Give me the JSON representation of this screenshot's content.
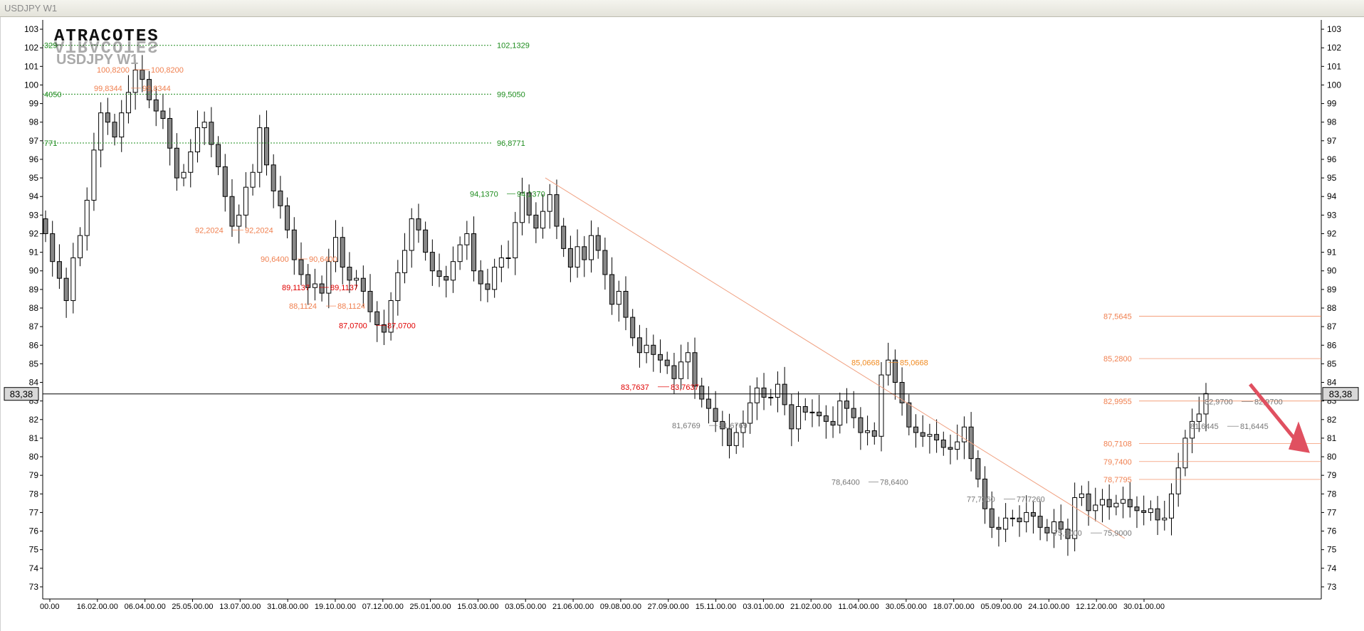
{
  "window": {
    "title": "USDJPY W1"
  },
  "header": {
    "logo": "ATRACOTES",
    "symbol": "USDJPY W1"
  },
  "current_price": {
    "label": "83,38",
    "value": 83.38,
    "color": "#000000"
  },
  "colors": {
    "up_fill": "#ffffff",
    "down_fill": "#888888",
    "wick": "#000000",
    "support_levels": "#1e8c1e",
    "resistance_levels": "#f08050",
    "pivot_labels": "#f08050",
    "trend_line": "#f0a080",
    "forecast_arrow": "#e05060"
  },
  "chart_data": {
    "type": "candlestick",
    "title": "USDJPY W1",
    "xlabel": "",
    "ylabel": "",
    "ylim": [
      72,
      104
    ],
    "y_ticks": [
      73,
      74,
      75,
      76,
      77,
      78,
      79,
      80,
      81,
      82,
      83,
      84,
      85,
      86,
      87,
      88,
      89,
      90,
      91,
      92,
      93,
      94,
      95,
      96,
      97,
      98,
      99,
      100,
      101,
      102,
      103
    ],
    "x_tick_labels": [
      "00.00",
      "16.02.00.00",
      "06.04.00.00",
      "25.05.00.00",
      "13.07.00.00",
      "31.08.00.00",
      "19.10.00.00",
      "07.12.00.00",
      "25.01.00.00",
      "15.03.00.00",
      "03.05.00.00",
      "21.06.00.00",
      "09.08.00.00",
      "27.09.00.00",
      "15.11.00.00",
      "03.01.00.00",
      "21.02.00.00",
      "11.04.00.00",
      "30.05.00.00",
      "18.07.00.00",
      "05.09.00.00",
      "24.10.00.00",
      "12.12.00.00",
      "30.01.00.00"
    ],
    "series_close": [
      92,
      90.5,
      89.6,
      88.4,
      90.7,
      91.9,
      93.8,
      96.5,
      98.5,
      98,
      97.2,
      98.5,
      99.6,
      100.8,
      100.3,
      99.2,
      98.6,
      98.2,
      96.6,
      95,
      95.3,
      96.4,
      97.7,
      98,
      96.8,
      95.6,
      94,
      92.4,
      93,
      94.5,
      95.3,
      97.7,
      95.7,
      94.3,
      93.5,
      92.2,
      90.6,
      89.8,
      89.1,
      89.3,
      88.8,
      90.5,
      91.8,
      90.2,
      89.5,
      89.6,
      88.9,
      87.8,
      87.1,
      86.7,
      88.4,
      89.9,
      91.1,
      92.8,
      92.2,
      91,
      90,
      89.7,
      89.5,
      90.5,
      91.4,
      92,
      90,
      89.3,
      89,
      90.2,
      90.7,
      90.7,
      92.6,
      94.2,
      93,
      92.3,
      93.2,
      94.1,
      92.4,
      91.2,
      90.2,
      91.3,
      90.6,
      91.9,
      91.1,
      89.8,
      88.2,
      88.9,
      87.5,
      86.4,
      85.6,
      86,
      85.5,
      85.2,
      84.9,
      84.2,
      85.1,
      85.6,
      83.8,
      83.1,
      82.6,
      81.9,
      81.5,
      80.6,
      81.3,
      81.8,
      82.9,
      83.7,
      83.2,
      83.2,
      83.9,
      82.8,
      81.5,
      82.7,
      82.4,
      82.4,
      82.2,
      81.9,
      81.7,
      83,
      82.6,
      82.1,
      81.3,
      81.4,
      81.1,
      84.4,
      85.2,
      84,
      82.9,
      81.6,
      81.3,
      81.1,
      81.2,
      80.9,
      80.5,
      80.4,
      80.8,
      81.6,
      79.9,
      78.8,
      77.2,
      76.2,
      76.1,
      76.7,
      76.7,
      76.5,
      77,
      76.8,
      76.2,
      75.9,
      76.5,
      76.1,
      75.6,
      77.8,
      78,
      77.1,
      77.4,
      77.7,
      77.3,
      77.5,
      77.7,
      77.3,
      77.1,
      77,
      77.2,
      76.6,
      76.7,
      78,
      79.4,
      81,
      81.9,
      82.3,
      83.4
    ],
    "levels_green": [
      {
        "label": "102,1329",
        "value": 102.1329
      },
      {
        "label": "99,5050",
        "value": 99.505
      },
      {
        "label": "96,8771",
        "value": 96.8771
      }
    ],
    "levels_orange_right": [
      {
        "label": "87,5645",
        "value": 87.5645
      },
      {
        "label": "85,2800",
        "value": 85.28
      },
      {
        "label": "82,9955",
        "value": 82.9955
      },
      {
        "label": "80,7108",
        "value": 80.7108
      },
      {
        "label": "79,7400",
        "value": 79.74
      },
      {
        "label": "78,7795",
        "value": 78.7795
      }
    ],
    "pivot_labels": [
      {
        "text": "100,8200",
        "value": 100.82,
        "color": "#f08050"
      },
      {
        "text": "100,8200",
        "value": 100.82,
        "color": "#f08050"
      },
      {
        "text": "99,8344",
        "value": 99.8344,
        "color": "#f08050"
      },
      {
        "text": "99,8344",
        "value": 99.8344,
        "color": "#f08050"
      },
      {
        "text": "92,2024",
        "value": 92.2024,
        "color": "#f08050"
      },
      {
        "text": "92,2024",
        "value": 92.2024,
        "color": "#f08050"
      },
      {
        "text": "90,6400",
        "value": 90.64,
        "color": "#f08050"
      },
      {
        "text": "90,6400",
        "value": 90.64,
        "color": "#f08050"
      },
      {
        "text": "89,1137",
        "value": 89.1137,
        "color": "#e00000"
      },
      {
        "text": "89,1137",
        "value": 89.1137,
        "color": "#e00000"
      },
      {
        "text": "88,1124",
        "value": 88.1124,
        "color": "#f08050"
      },
      {
        "text": "88,1124",
        "value": 88.1124,
        "color": "#f08050"
      },
      {
        "text": "87,0700",
        "value": 87.07,
        "color": "#e00000"
      },
      {
        "text": "87,0700",
        "value": 87.07,
        "color": "#e00000"
      },
      {
        "text": "94,1370",
        "value": 94.137,
        "color": "#1e8c1e"
      },
      {
        "text": "94,1370",
        "value": 94.137,
        "color": "#1e8c1e"
      },
      {
        "text": "83,7637",
        "value": 83.7637,
        "color": "#e00000"
      },
      {
        "text": "83,7637",
        "value": 83.7637,
        "color": "#e00000"
      },
      {
        "text": "85,0668",
        "value": 85.0668,
        "color": "#f08a20"
      },
      {
        "text": "85,0668",
        "value": 85.0668,
        "color": "#f08a20"
      },
      {
        "text": "81,6769",
        "value": 81.6769,
        "color": "#777777"
      },
      {
        "text": "81,6769",
        "value": 81.6769,
        "color": "#777777"
      },
      {
        "text": "78,6400",
        "value": 78.64,
        "color": "#777777"
      },
      {
        "text": "78,6400",
        "value": 78.64,
        "color": "#777777"
      },
      {
        "text": "77,7260",
        "value": 77.726,
        "color": "#777777"
      },
      {
        "text": "77,7260",
        "value": 77.726,
        "color": "#777777"
      },
      {
        "text": "75,9000",
        "value": 75.9,
        "color": "#777777"
      },
      {
        "text": "75,9000",
        "value": 75.9,
        "color": "#777777"
      },
      {
        "text": "82,9700",
        "value": 82.97,
        "color": "#777777"
      },
      {
        "text": "82,9700",
        "value": 82.97,
        "color": "#777777"
      },
      {
        "text": "81,6445",
        "value": 81.6445,
        "color": "#777777"
      },
      {
        "text": "81,6445",
        "value": 81.6445,
        "color": "#777777"
      }
    ],
    "level_fragments_left": [
      "329",
      "4050",
      "771"
    ]
  }
}
